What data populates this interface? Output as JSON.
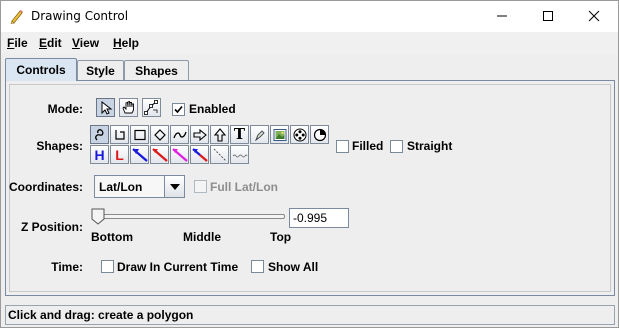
{
  "window": {
    "title": "Drawing Control"
  },
  "menu": {
    "items": [
      {
        "label": "File",
        "accel": "F",
        "rest": "ile"
      },
      {
        "label": "Edit",
        "accel": "E",
        "rest": "dit"
      },
      {
        "label": "View",
        "accel": "V",
        "rest": "iew"
      },
      {
        "label": "Help",
        "accel": "H",
        "rest": "elp"
      }
    ]
  },
  "tabs": [
    {
      "label": "Controls",
      "active": true
    },
    {
      "label": "Style",
      "active": false
    },
    {
      "label": "Shapes",
      "active": false
    }
  ],
  "mode": {
    "label": "Mode:",
    "tools": [
      "select-arrow-icon",
      "pan-hand-icon",
      "edit-points-icon"
    ],
    "enabled_label": "Enabled",
    "enabled_checked": true
  },
  "shapes": {
    "label": "Shapes:",
    "row1": [
      "freehand-curve-icon",
      "open-polygon-icon",
      "rectangle-icon",
      "diamond-icon",
      "smooth-curve-icon",
      "right-arrow-icon",
      "up-arrow-icon",
      "text-icon",
      "shape-tool-icon",
      "image-icon",
      "movie-reel-icon",
      "pie-icon"
    ],
    "row2": [
      "high-pressure-icon",
      "low-pressure-icon",
      "cold-front-icon",
      "warm-front-icon",
      "occluded-front-icon",
      "stationary-front-icon",
      "trough-icon",
      "squall-line-icon"
    ],
    "row2_text": {
      "high": "H",
      "low": "L",
      "text": "T"
    },
    "filled_label": "Filled",
    "filled_checked": false,
    "straight_label": "Straight",
    "straight_checked": false
  },
  "coordinates": {
    "label": "Coordinates:",
    "value": "Lat/Lon",
    "full_latlon_label": "Full Lat/Lon",
    "full_latlon_checked": false,
    "full_latlon_enabled": false
  },
  "zposition": {
    "label": "Z Position:",
    "value": "-0.995",
    "ticks": [
      "Bottom",
      "Middle",
      "Top"
    ],
    "level_fraction": 0.0025
  },
  "time": {
    "label": "Time:",
    "draw_current_label": "Draw In Current Time",
    "draw_current_checked": false,
    "show_all_label": "Show All",
    "show_all_checked": false
  },
  "status": {
    "text": "Click and drag: create a polygon"
  },
  "colors": {
    "accent": "#dbe6f3",
    "panel_border": "#7a8aa0",
    "high_blue": "#1a1adc",
    "low_red": "#dc1a1a",
    "warm_magenta": "#e020e0"
  }
}
